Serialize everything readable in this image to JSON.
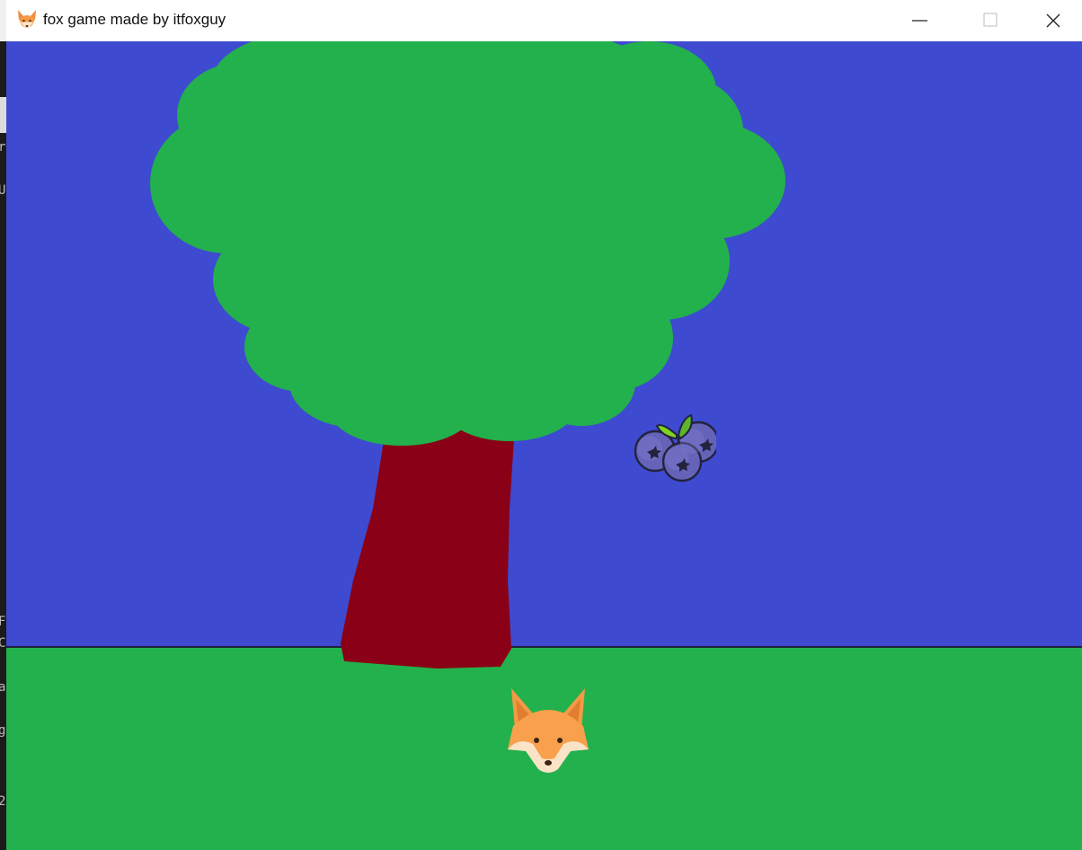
{
  "window": {
    "title": "fox game made by itfoxguy",
    "icon": "fox-head-icon",
    "controls": [
      "minimize-icon",
      "maximize-icon",
      "close-icon"
    ]
  },
  "scene": {
    "sky_color": "#3e4ad0",
    "ground_color": "#22b14c",
    "foliage_color": "#22b14c",
    "trunk_color": "#8a0016",
    "sprites": [
      "tree",
      "blueberries",
      "fox-head"
    ]
  },
  "background_fragments": [
    "r",
    "U",
    "F",
    "C",
    "a",
    "g",
    "2"
  ]
}
